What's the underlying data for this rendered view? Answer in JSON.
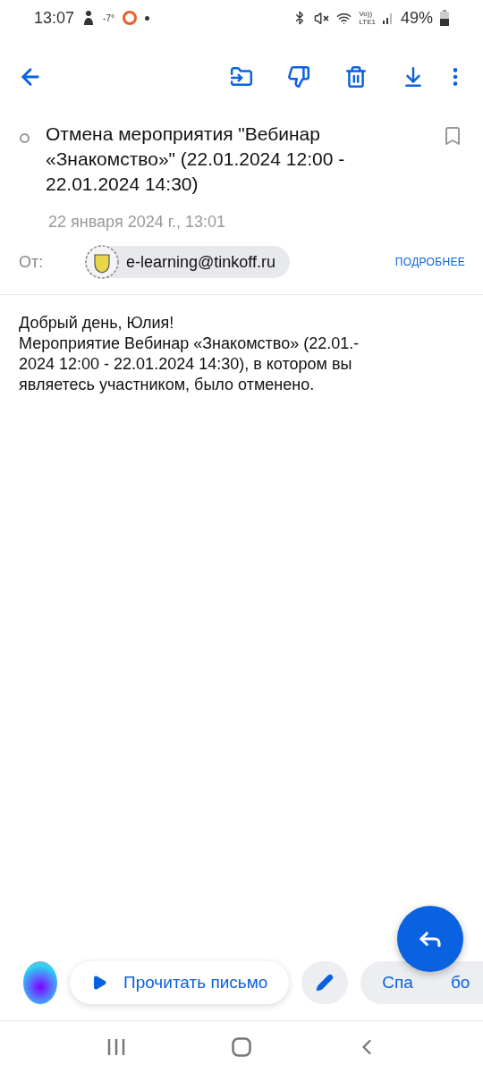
{
  "status_bar": {
    "time": "13:07",
    "temperature": "-7°",
    "volte": "Vo))",
    "network": "LTE1",
    "battery": "49%"
  },
  "toolbar": {
    "actions": [
      {
        "kind": "move"
      },
      {
        "kind": "spam"
      },
      {
        "kind": "delete"
      },
      {
        "kind": "save"
      },
      {
        "kind": "more"
      }
    ]
  },
  "message": {
    "unread": false,
    "bookmarked": false,
    "subject": "Отмена мероприятия \"Вебинар «Знакомство»\" (22.01.2024 12:00 - 22.01.2024 14:30)",
    "date": "22 января 2024 г., 13:01",
    "from_label": "От:",
    "sender": "e-learning@tinkoff.ru",
    "details_link": "ПОДРОБНЕЕ"
  },
  "body": {
    "greeting": "Добрый день, Юлия!",
    "lines": [
      "Мероприятие Вебинар «Знакомство» (22.01.-",
      "2024 12:00 - 22.01.2024 14:30), в котором вы",
      "являетесь участником, было отменено."
    ]
  },
  "quick_bar": {
    "read_aloud": "Прочитать письмо",
    "reply_chip_start": "Спа",
    "reply_chip_end": "бо"
  }
}
